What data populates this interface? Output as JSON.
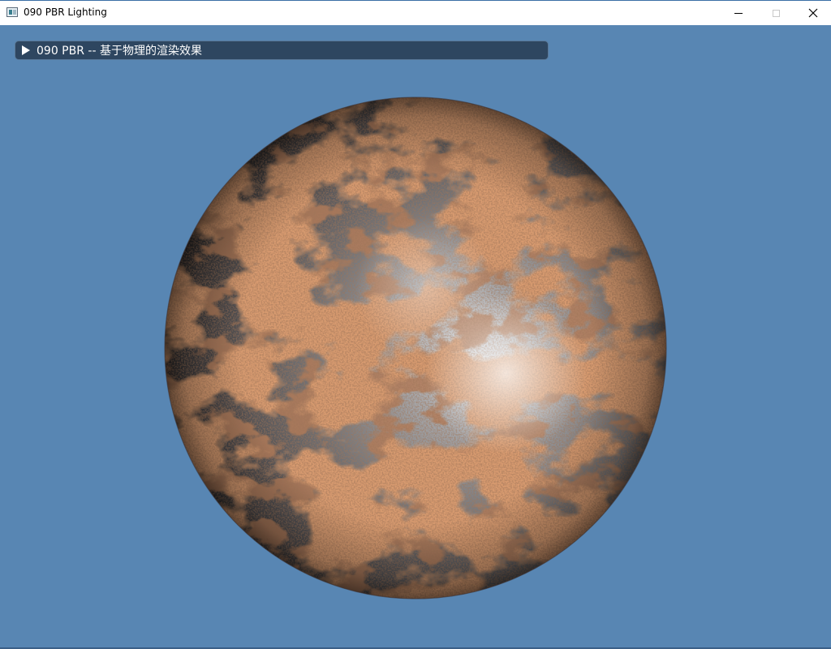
{
  "window": {
    "title": "090 PBR Lighting",
    "icon": "app-window-icon",
    "controls": {
      "minimize_icon": "minimize-icon",
      "maximize_icon": "maximize-icon",
      "close_icon": "close-icon",
      "close_glyph": "✕"
    }
  },
  "imgui": {
    "header_label": "090 PBR -- 基于物理的渲染效果",
    "collapsed": true,
    "arrow_icon": "collapsed-arrow-icon"
  },
  "scene": {
    "background_color": "#5886b3",
    "object": "rusted-metal-sphere",
    "rust_color": "#b0532a",
    "metal_color": "#8a8c90"
  }
}
